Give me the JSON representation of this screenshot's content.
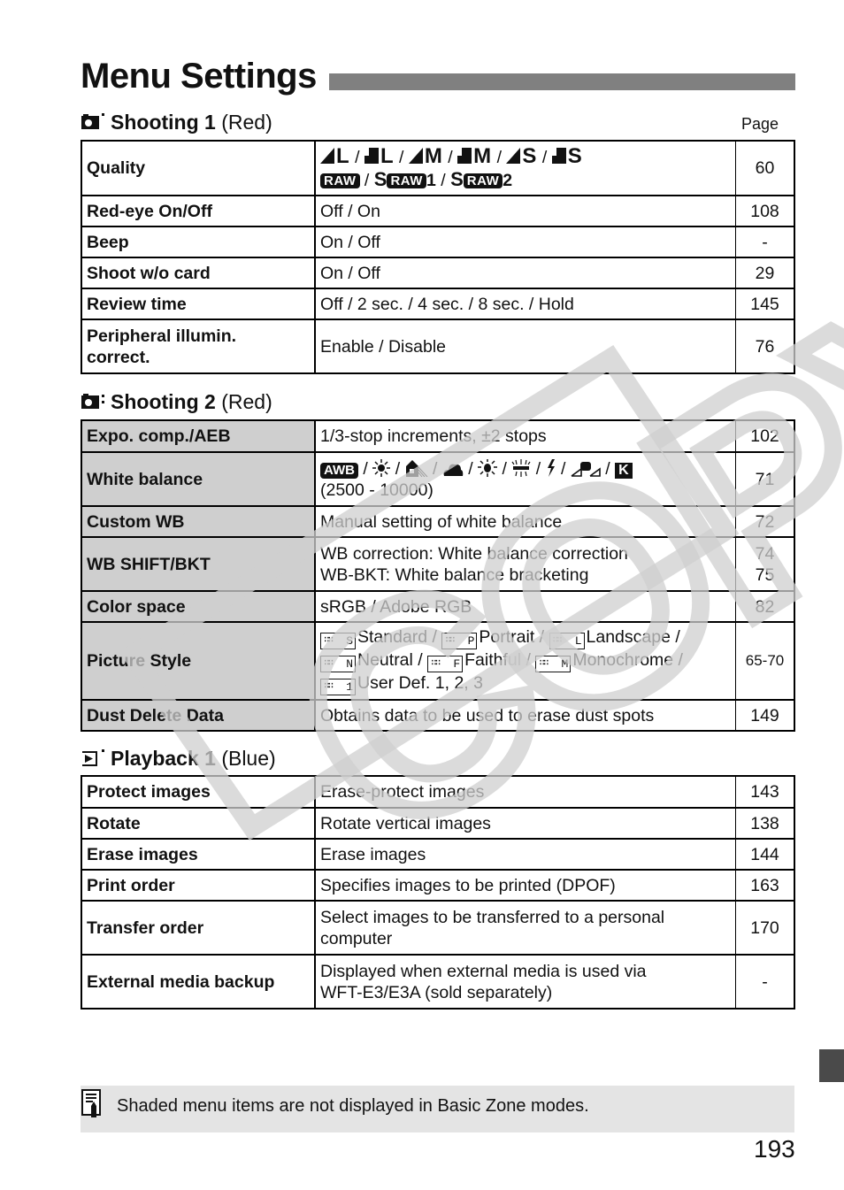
{
  "page": {
    "title": "Menu Settings",
    "page_column_header": "Page",
    "page_number": "193",
    "colors": {
      "title_bar": "#808080",
      "shaded_cell": "#cfcfcf",
      "note_background": "#e4e4e4",
      "side_tab": "#4a4a4a",
      "watermark": "#d0d0d0"
    },
    "watermark_text": "COPY"
  },
  "sections": [
    {
      "icon": "camera-shooting-1-icon",
      "name": "Shooting 1",
      "color_label": "(Red)",
      "rows": [
        {
          "item": "Quality",
          "settings_icons": [
            "large-fine-icon",
            "large-normal-icon",
            "medium-fine-icon",
            "medium-normal-icon",
            "small-fine-icon",
            "small-normal-icon",
            "raw-icon",
            "sraw1-icon",
            "sraw2-icon"
          ],
          "settings_text": {
            "l": "L",
            "m": "M",
            "s": "S",
            "raw": "RAW",
            "s_prefix": "S",
            "one": "1",
            "two": "2",
            "sep": "/"
          },
          "page": "60",
          "shaded": false
        },
        {
          "item": "Red-eye On/Off",
          "settings": "Off / On",
          "page": "108",
          "shaded": false
        },
        {
          "item": "Beep",
          "settings": "On / Off",
          "page": "-",
          "shaded": false
        },
        {
          "item": "Shoot w/o card",
          "settings": "On / Off",
          "page": "29",
          "shaded": false
        },
        {
          "item": "Review time",
          "settings": "Off / 2 sec. / 4 sec. / 8 sec. / Hold",
          "page": "145",
          "shaded": false
        },
        {
          "item": "Peripheral illumin. correct.",
          "item_lines": [
            "Peripheral illumin.",
            "correct."
          ],
          "settings": "Enable / Disable",
          "page": "76",
          "shaded": false
        }
      ]
    },
    {
      "icon": "camera-shooting-2-icon",
      "name": "Shooting 2",
      "color_label": "(Red)",
      "rows": [
        {
          "item": "Expo. comp./AEB",
          "settings": "1/3-stop increments, ±2 stops",
          "page": "102",
          "shaded": true
        },
        {
          "item": "White balance",
          "settings_icons": [
            "awb-icon",
            "daylight-icon",
            "shade-icon",
            "cloudy-icon",
            "tungsten-icon",
            "fluorescent-icon",
            "flash-icon",
            "custom-wb-icon",
            "color-temperature-icon"
          ],
          "settings_text": {
            "awb": "AWB",
            "k": "K",
            "range": "(2500 - 10000)",
            "sep": "/"
          },
          "page": "71",
          "shaded": true
        },
        {
          "item": "Custom WB",
          "settings": "Manual setting of white balance",
          "page": "72",
          "shaded": true
        },
        {
          "item": "WB SHIFT/BKT",
          "settings_lines": [
            "WB correction: White balance correction",
            "WB-BKT: White balance bracketing"
          ],
          "page_lines": [
            "74",
            "75"
          ],
          "shaded": true
        },
        {
          "item": "Color space",
          "settings": "sRGB / Adobe RGB",
          "page": "82",
          "shaded": true
        },
        {
          "item": "Picture Style",
          "styles": [
            {
              "icon_letter": "S",
              "label": "Standard /"
            },
            {
              "icon_letter": "P",
              "label": "Portrait /"
            },
            {
              "icon_letter": "L",
              "label": "Landscape /"
            },
            {
              "icon_letter": "N",
              "label": "Neutral /"
            },
            {
              "icon_letter": "F",
              "label": "Faithful /"
            },
            {
              "icon_letter": "M",
              "label": "Monochrome /"
            },
            {
              "icon_letter": "1",
              "label": "User Def. 1, 2, 3"
            }
          ],
          "page": "65-70",
          "shaded": true
        },
        {
          "item": "Dust Delete Data",
          "settings": "Obtains data to be used to erase dust spots",
          "page": "149",
          "shaded": true
        }
      ]
    },
    {
      "icon": "playback-1-icon",
      "name": "Playback 1",
      "color_label": "(Blue)",
      "rows": [
        {
          "item": "Protect images",
          "settings": "Erase-protect images",
          "page": "143",
          "shaded": false
        },
        {
          "item": "Rotate",
          "settings": "Rotate vertical images",
          "page": "138",
          "shaded": false
        },
        {
          "item": "Erase images",
          "settings": "Erase images",
          "page": "144",
          "shaded": false
        },
        {
          "item": "Print order",
          "settings": "Specifies images to be printed (DPOF)",
          "page": "163",
          "shaded": false
        },
        {
          "item": "Transfer order",
          "settings_lines": [
            "Select images to be transferred to a personal",
            "computer"
          ],
          "page": "170",
          "shaded": false
        },
        {
          "item": "External media backup",
          "settings_lines": [
            "Displayed when external media is used via",
            "WFT-E3/E3A (sold separately)"
          ],
          "page": "-",
          "shaded": false
        }
      ]
    }
  ],
  "note": {
    "icon": "memo-pencil-icon",
    "text": "Shaded menu items are not displayed in Basic Zone modes."
  }
}
